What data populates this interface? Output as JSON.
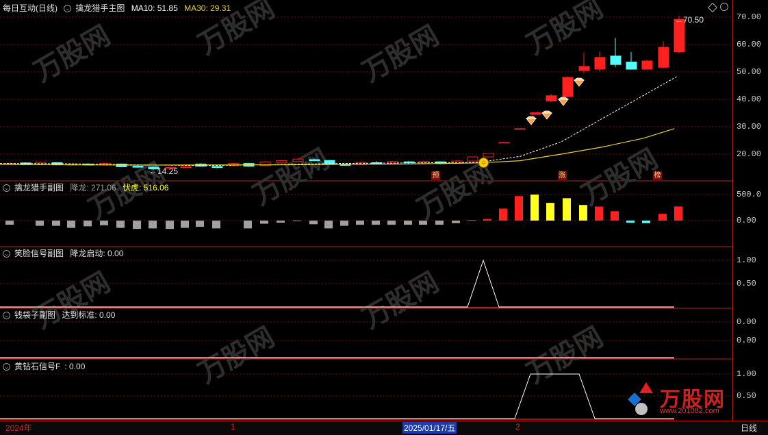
{
  "main_panel": {
    "stock_label": "每日互动(日线)",
    "indicator_label": "擒龙猎手主图",
    "ma10_label": "MA10: 51.85",
    "ma30_label": "MA30: 29.31",
    "high_label": "70.50",
    "low_label": "14.25",
    "markers": [
      "预",
      "涨",
      "榜"
    ],
    "y_ticks": [
      "70.00",
      "60.00",
      "50.00",
      "40.00",
      "30.00",
      "20.00"
    ]
  },
  "sub1": {
    "title": "擒龙猎手副图",
    "v1_label": "降龙: 271.06",
    "v2_label": "伏虎: 516.06",
    "y_ticks": [
      "500.0",
      "0.00"
    ]
  },
  "sub2": {
    "title": "笑脸信号副图",
    "v1_label": "降龙启动: 0.00",
    "y_ticks": [
      "1.00",
      "0.50"
    ]
  },
  "sub3": {
    "title": "钱袋子副图",
    "v1_label": "达到标准: 0.00",
    "y_ticks": [
      "0.00",
      "0.00"
    ]
  },
  "sub4": {
    "title": "黄钻石信号F",
    "v1_label": ": 0.00",
    "y_ticks": [
      "1.00",
      "0.50"
    ]
  },
  "date_bar": {
    "start_label": "2024年",
    "month1": "1",
    "cursor_date": "2025/01/17/五",
    "month2": "2",
    "period_label": "日线"
  },
  "watermark": {
    "text": "www.201082.com",
    "brand": "万股网"
  },
  "colors": {
    "up": "#ff2020",
    "down": "#54ffff",
    "ma10": "#ffffff",
    "ma30": "#e6d23a",
    "bar_gray": "#a0a0a0",
    "bar_yellow": "#ffff20",
    "grid": "#7a1010"
  }
}
